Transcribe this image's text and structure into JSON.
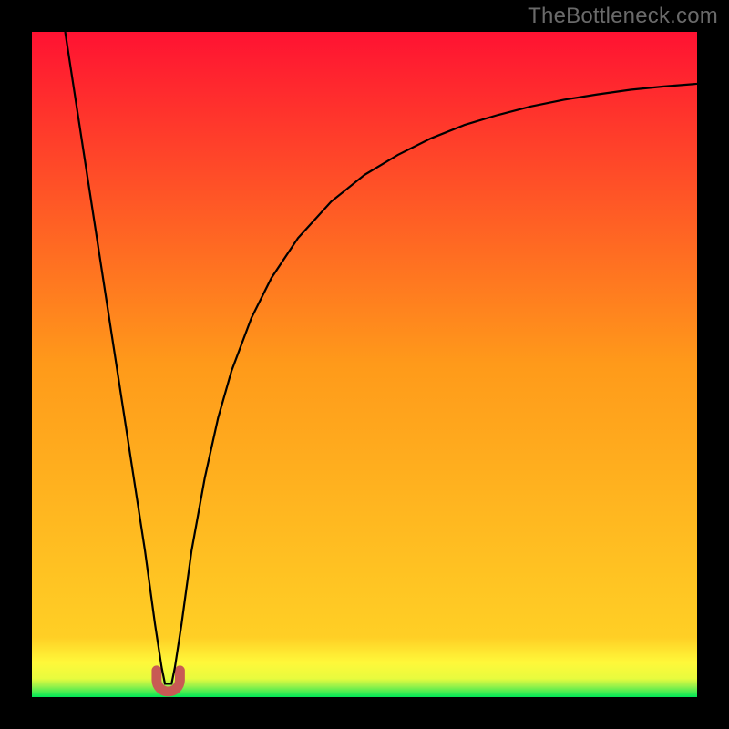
{
  "watermark": "TheBottleneck.com",
  "chart_data": {
    "type": "line",
    "title": "",
    "xlabel": "",
    "ylabel": "",
    "xlim": [
      0,
      100
    ],
    "ylim": [
      0,
      100
    ],
    "grid": false,
    "background_gradient": [
      "#00e756",
      "#fff83a",
      "#ff9a1a",
      "#ff1232"
    ],
    "series": [
      {
        "name": "curve",
        "color": "#000000",
        "x": [
          5,
          7,
          9,
          11,
          13,
          15,
          17,
          18.5,
          19.5,
          20,
          21,
          21.5,
          22.5,
          24,
          26,
          28,
          30,
          33,
          36,
          40,
          45,
          50,
          55,
          60,
          65,
          70,
          75,
          80,
          85,
          90,
          95,
          100
        ],
        "y": [
          100,
          87,
          74,
          61,
          48,
          35,
          22,
          11,
          4.5,
          2,
          2,
          4.5,
          11,
          22,
          33,
          42,
          49,
          57,
          63,
          69,
          74.5,
          78.5,
          81.5,
          84,
          86,
          87.5,
          88.8,
          89.8,
          90.6,
          91.3,
          91.8,
          92.2
        ]
      }
    ],
    "annotations": [
      {
        "name": "min-marker",
        "shape": "u",
        "color": "#c85a54",
        "x": 20.5,
        "y": 1.2,
        "width": 3.5,
        "height": 2.8
      }
    ]
  }
}
